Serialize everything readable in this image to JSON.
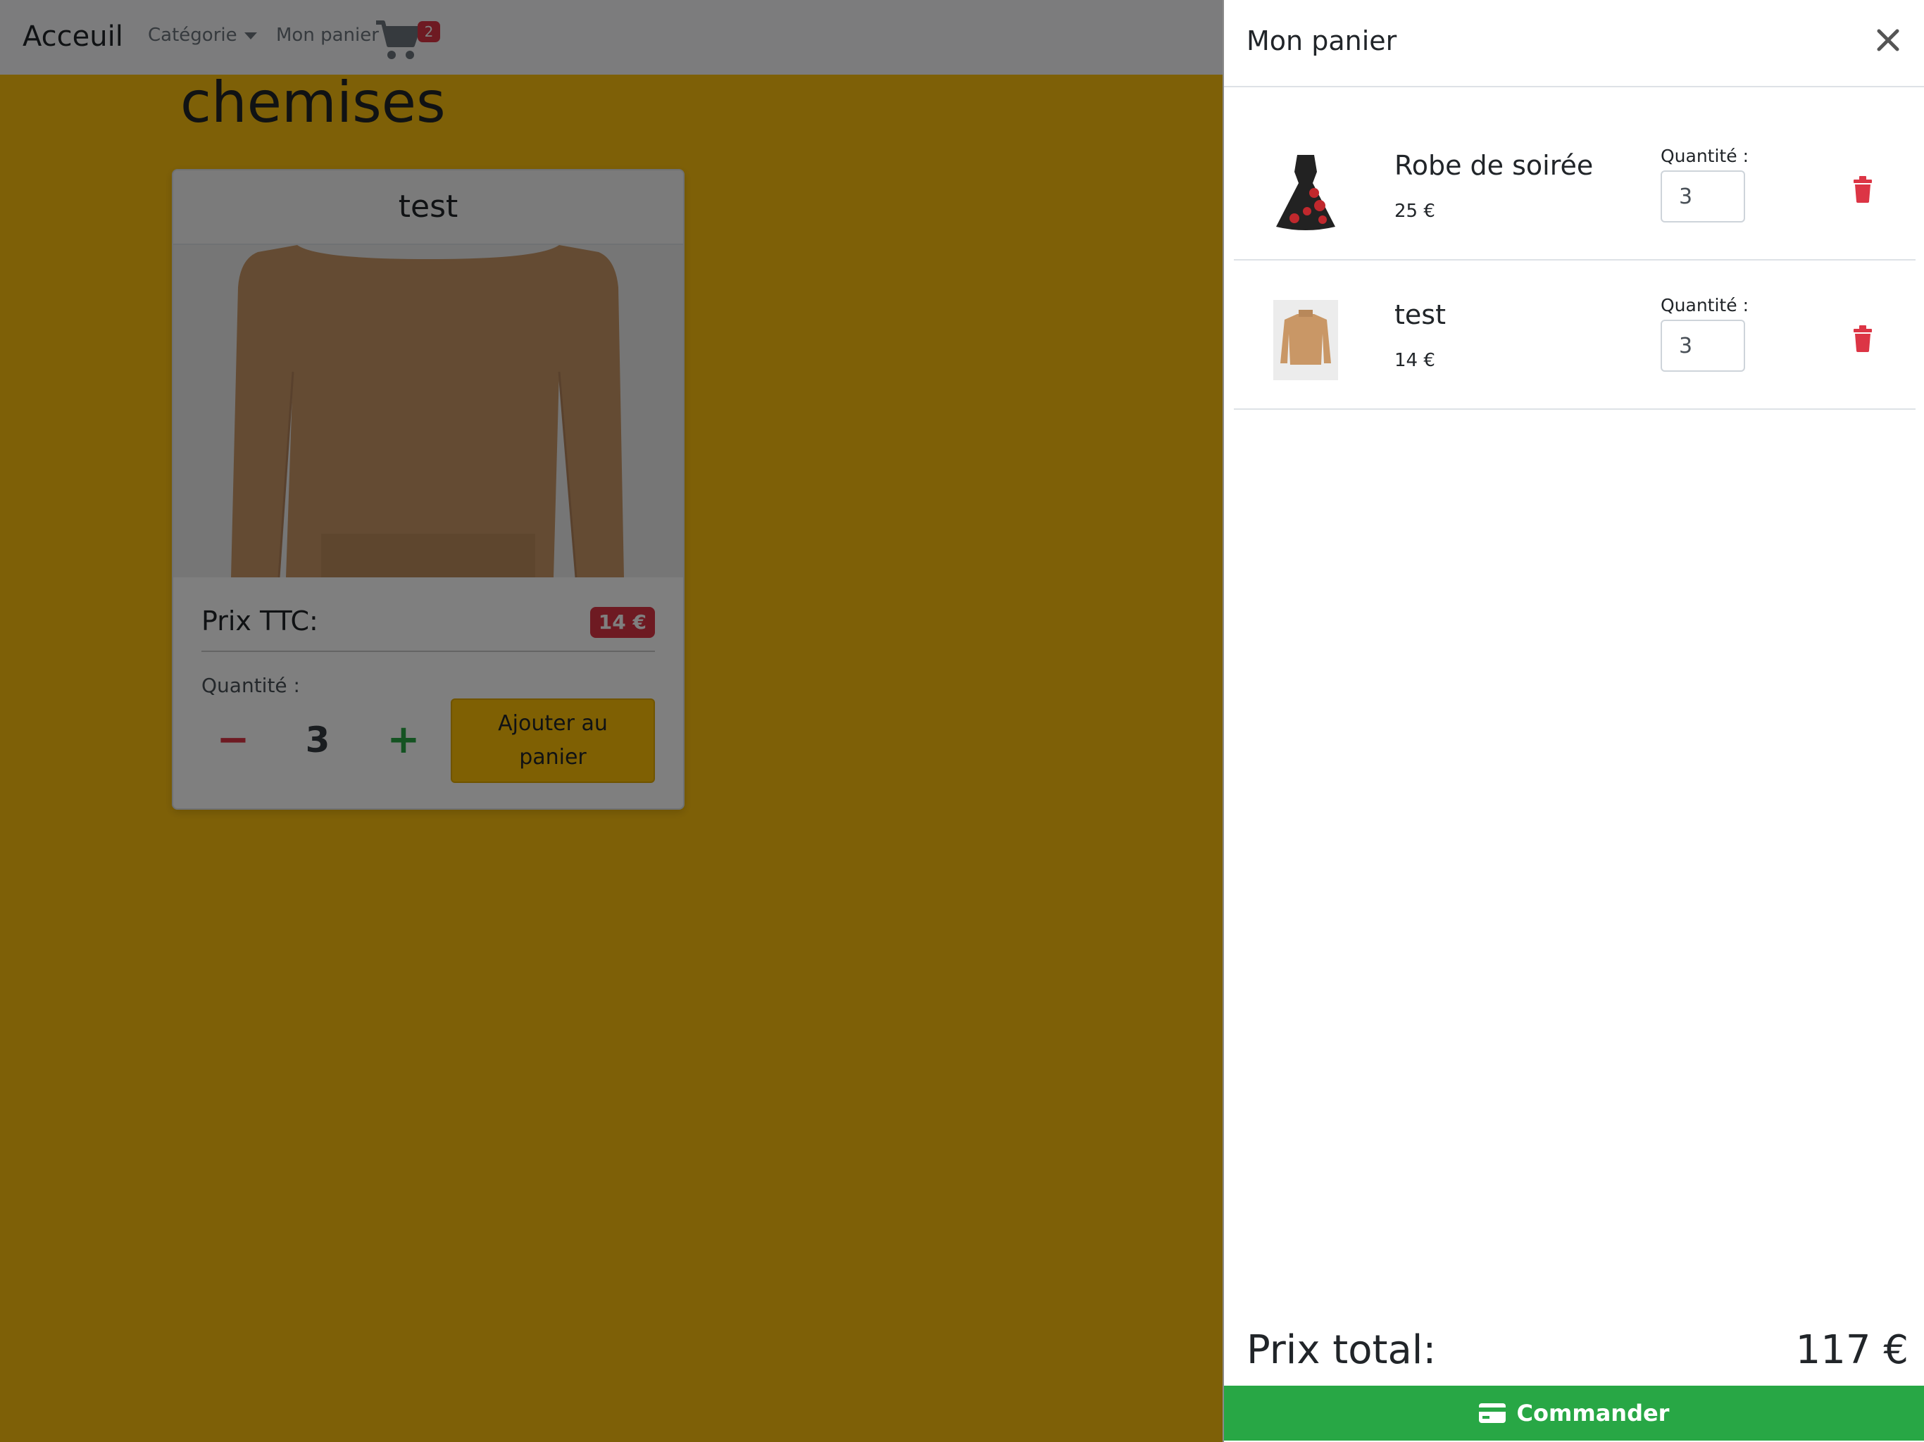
{
  "navbar": {
    "brand": "Acceuil",
    "category_label": "Catégorie",
    "cart_label": "Mon panier",
    "cart_count": "2"
  },
  "page": {
    "heading": "chemises"
  },
  "product_card": {
    "title": "test",
    "price_label": "Prix TTC:",
    "price": "14 €",
    "quantity_label": "Quantité :",
    "quantity_value": "3",
    "add_button": "Ajouter au panier"
  },
  "cart_panel": {
    "title": "Mon panier",
    "items": [
      {
        "name": "Robe de soirée",
        "price": "25 €",
        "quantity_label": "Quantité :",
        "quantity": "3",
        "thumbnail": "dress"
      },
      {
        "name": "test",
        "price": "14 €",
        "quantity_label": "Quantité :",
        "quantity": "3",
        "thumbnail": "sweater"
      }
    ],
    "total_label": "Prix total:",
    "total_value": "117 €",
    "order_button": "Commander"
  },
  "colors": {
    "page_background": "#fdc10f",
    "danger": "#dc3545",
    "success": "#28a745",
    "warning": "#ffc107"
  }
}
